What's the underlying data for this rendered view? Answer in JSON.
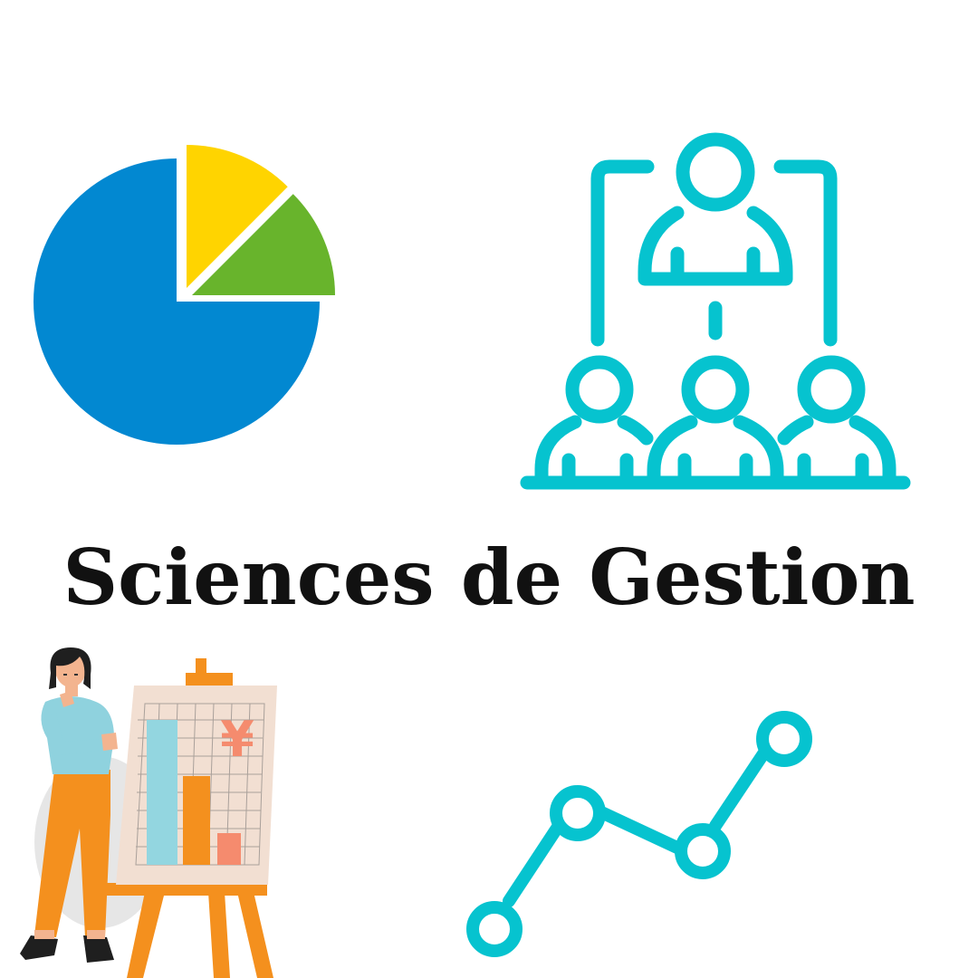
{
  "title": "Sciences de Gestion",
  "currency_symbol": "¥",
  "colors": {
    "teal": "#06C3CF",
    "pie_blue": "#0288D1",
    "pie_yellow": "#FFD400",
    "pie_green": "#68B42C",
    "orange": "#F4901E",
    "light_blue": "#93D6E0",
    "salmon": "#F58B6E",
    "board": "#F2DFD2"
  },
  "icons": [
    "pie-chart-icon",
    "team-hierarchy-icon",
    "woman-presenter-illustration",
    "line-graph-icon"
  ]
}
